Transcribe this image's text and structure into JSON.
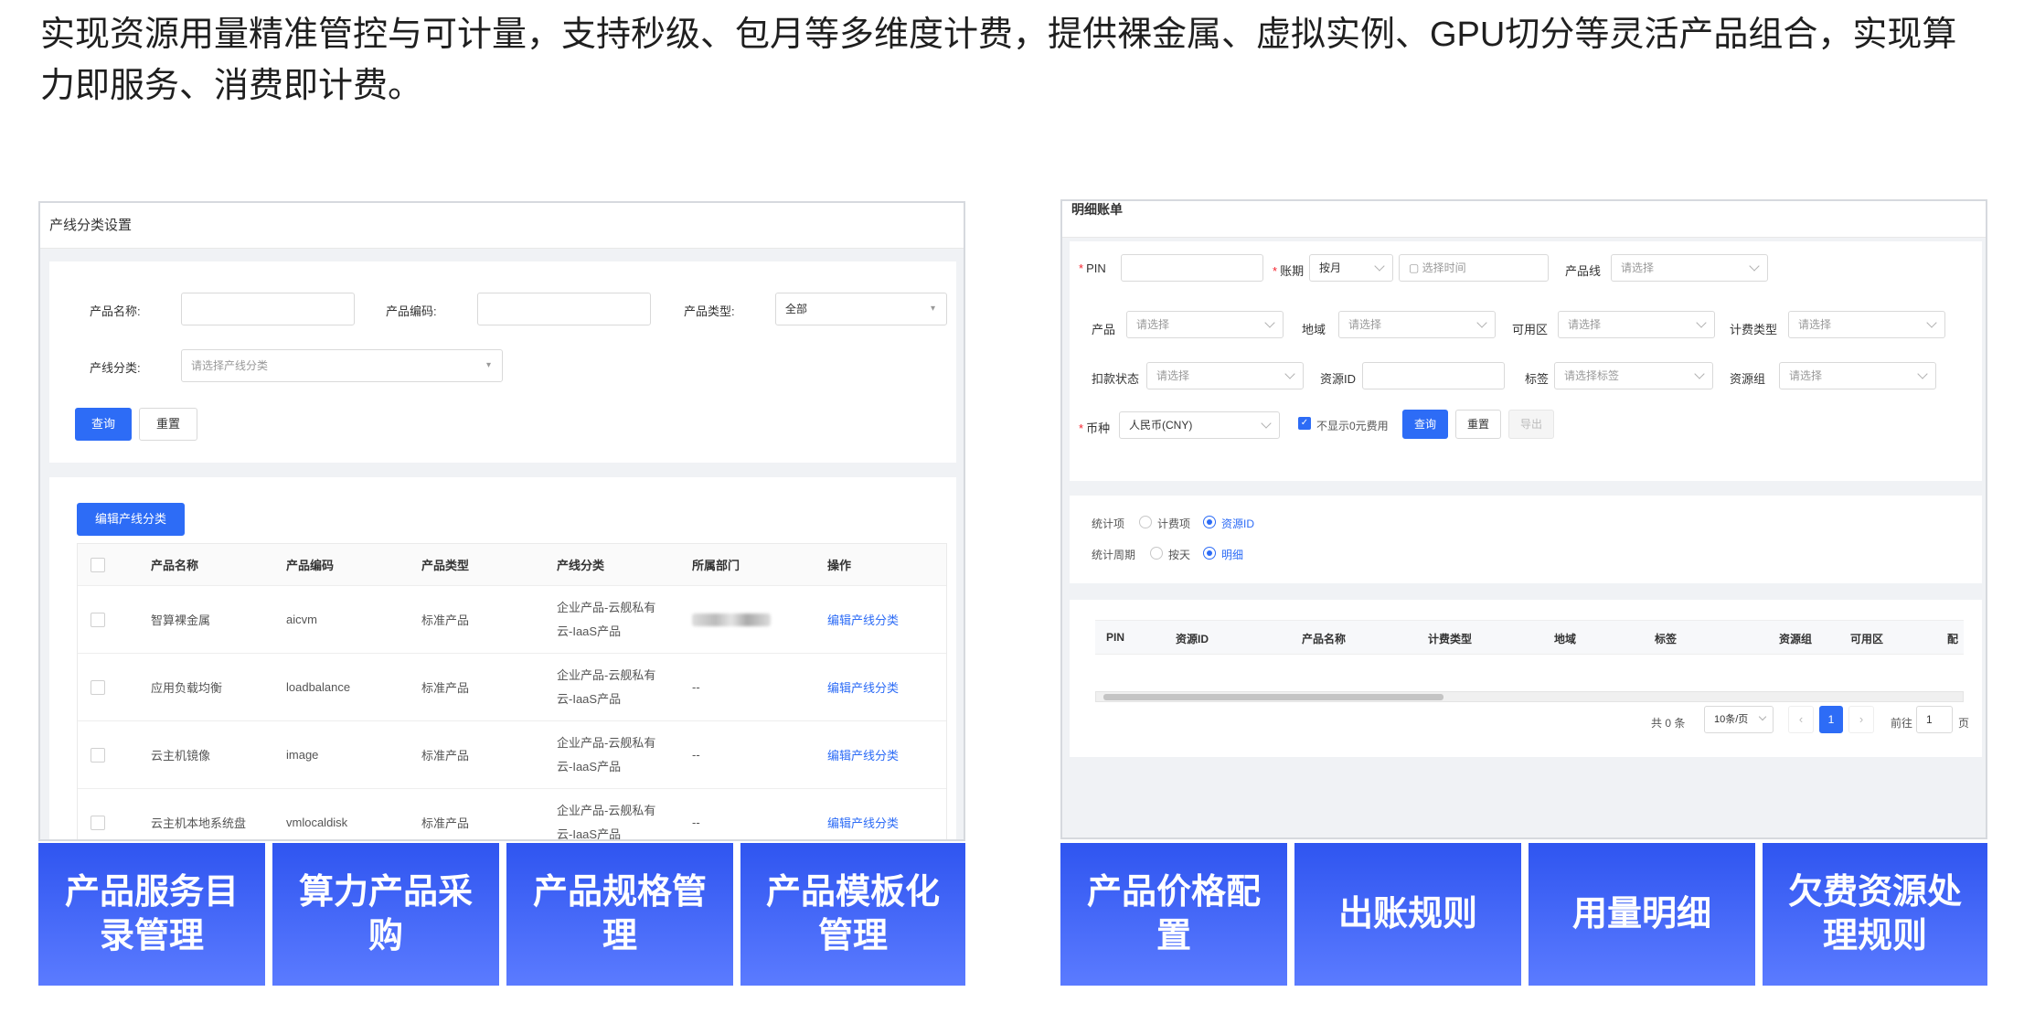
{
  "intro": "实现资源用量精准管控与可计量，支持秒级、包月等多维度计费，提供裸金属、虚拟实例、GPU切分等灵活产品组合，实现算力即服务、消费即计费。",
  "left": {
    "title": "产线分类设置",
    "filters": {
      "name_label": "产品名称:",
      "code_label": "产品编码:",
      "type_label": "产品类型:",
      "type_value": "全部",
      "category_label": "产线分类:",
      "category_placeholder": "请选择产线分类",
      "query": "查询",
      "reset": "重置"
    },
    "edit_button": "编辑产线分类",
    "columns": [
      "产品名称",
      "产品编码",
      "产品类型",
      "产线分类",
      "所属部门",
      "操作"
    ],
    "rows": [
      {
        "name": "智算裸金属",
        "code": "aicvm",
        "type": "标准产品",
        "cat1": "企业产品-云舰私有",
        "cat2": "云-IaaS产品",
        "dept": "",
        "op": "编辑产线分类"
      },
      {
        "name": "应用负载均衡",
        "code": "loadbalance",
        "type": "标准产品",
        "cat1": "企业产品-云舰私有",
        "cat2": "云-IaaS产品",
        "dept": "--",
        "op": "编辑产线分类"
      },
      {
        "name": "云主机镜像",
        "code": "image",
        "type": "标准产品",
        "cat1": "企业产品-云舰私有",
        "cat2": "云-IaaS产品",
        "dept": "--",
        "op": "编辑产线分类"
      },
      {
        "name": "云主机本地系统盘",
        "code": "vmlocaldisk",
        "type": "标准产品",
        "cat1": "企业产品-云舰私有",
        "cat2": "云-IaaS产品",
        "dept": "--",
        "op": "编辑产线分类"
      }
    ]
  },
  "right": {
    "title": "明细账单",
    "f": {
      "pin": "PIN",
      "period": "账期",
      "period_value": "按月",
      "time_placeholder": "选择时间",
      "product_line": "产品线",
      "select": "请选择",
      "product": "产品",
      "region": "地域",
      "az": "可用区",
      "billing_type": "计费类型",
      "deduct": "扣款状态",
      "resource_id": "资源ID",
      "tag": "标签",
      "tag_placeholder": "请选择标签",
      "resource_group": "资源组",
      "currency": "币种",
      "currency_value": "人民币(CNY)",
      "hide_zero": "不显示0元费用",
      "query": "查询",
      "reset": "重置",
      "export": "导出"
    },
    "stat": {
      "item_label": "统计项",
      "opt_billing": "计费项",
      "opt_resource": "资源ID",
      "cycle_label": "统计周期",
      "opt_day": "按天",
      "opt_detail": "明细"
    },
    "columns": [
      "PIN",
      "资源ID",
      "产品名称",
      "计费类型",
      "地域",
      "标签",
      "资源组",
      "可用区",
      "配"
    ],
    "pager": {
      "total": "共 0 条",
      "size": "10条/页",
      "page": "1",
      "goto": "前往",
      "goto_value": "1",
      "page_unit": "页"
    }
  },
  "tiles": [
    "产品服务目录管理",
    "算力产品采购",
    "产品规格管理",
    "产品模板化管理",
    "产品价格配置",
    "出账规则",
    "用量明细",
    "欠费资源处理规则"
  ]
}
